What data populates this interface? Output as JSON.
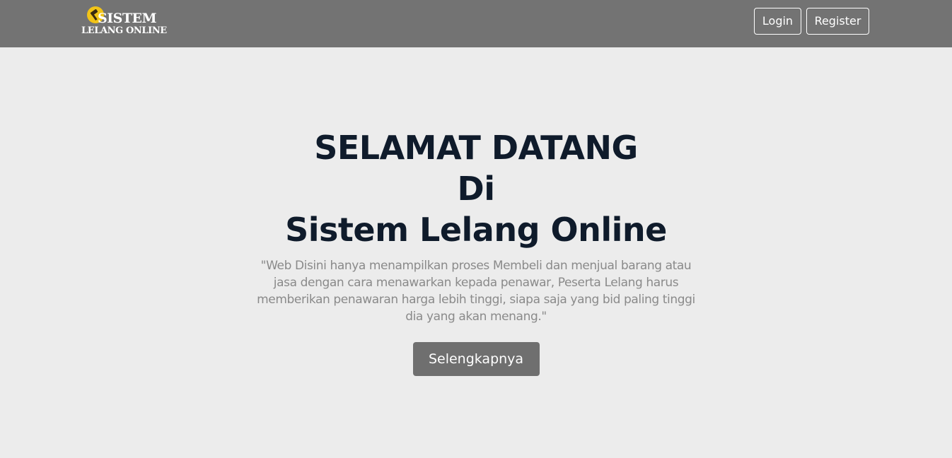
{
  "header": {
    "logo": {
      "line1": "SISTEM",
      "line2": "LELANG ONLINE",
      "icon": "gavel-icon",
      "accent_color": "#f2c417"
    },
    "login_label": "Login",
    "register_label": "Register",
    "background_color": "#737373"
  },
  "hero": {
    "title_line1": "SELAMAT DATANG",
    "title_line2": "Di",
    "title_line3": "Sistem Lelang Online",
    "description": "\"Web Disini hanya menampilkan proses Membeli dan menjual barang atau jasa dengan cara menawarkan kepada penawar, Peserta Lelang harus memberikan penawaran harga lebih tinggi, siapa saja yang bid paling tinggi dia yang akan menang.\"",
    "cta_label": "Selengkapnya",
    "title_color": "#0f1b2b",
    "cta_color": "#6f6f6f"
  }
}
